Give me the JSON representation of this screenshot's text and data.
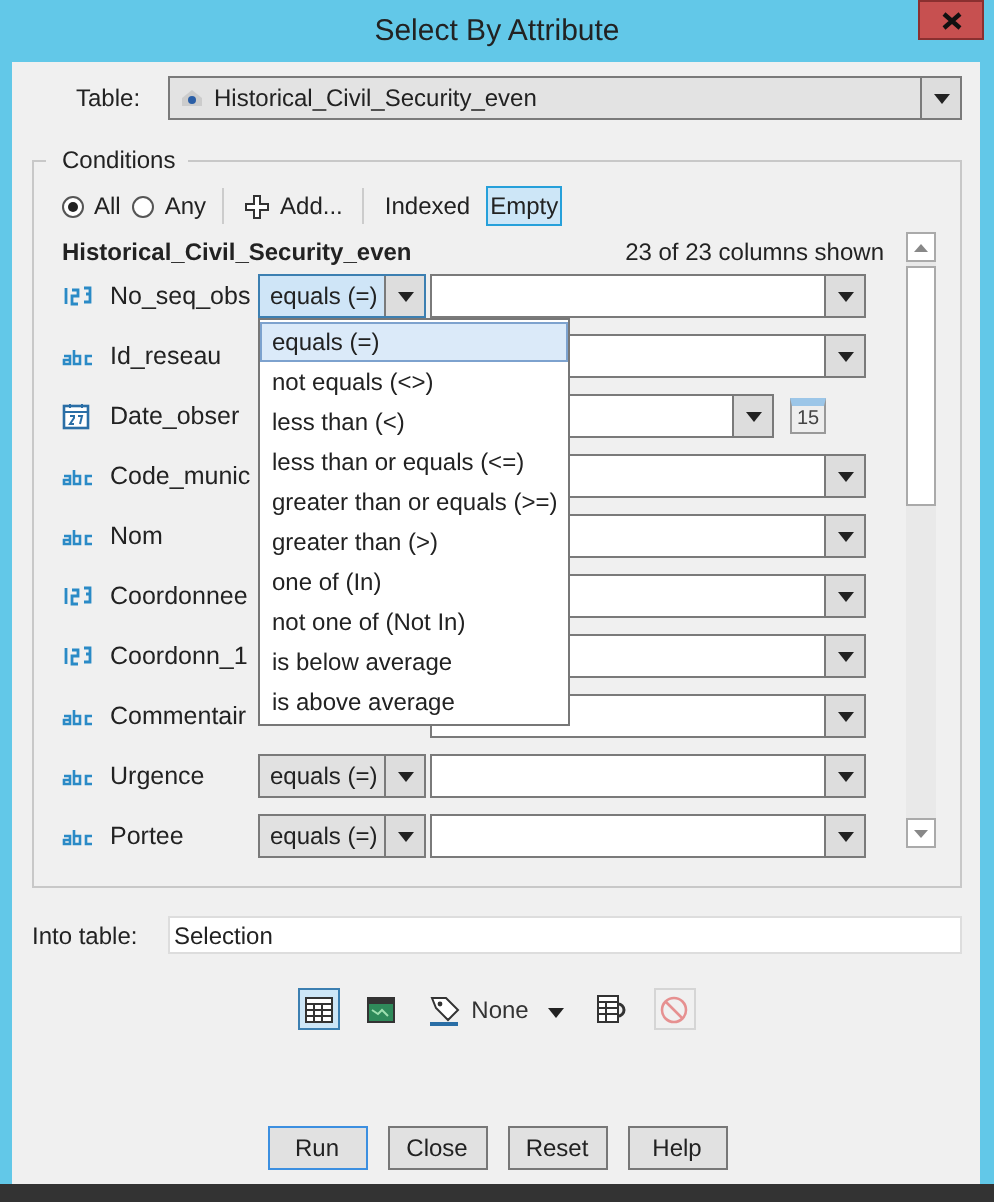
{
  "window": {
    "title": "Select By Attribute"
  },
  "table": {
    "label": "Table:",
    "value": "Historical_Civil_Security_even"
  },
  "conditions": {
    "title": "Conditions",
    "match": [
      {
        "label": "All",
        "selected": true
      },
      {
        "label": "Any",
        "selected": false
      }
    ],
    "add_label": "Add...",
    "filters": [
      {
        "label": "Indexed",
        "selected": false
      },
      {
        "label": "Empty",
        "selected": true
      }
    ],
    "layer_name": "Historical_Civil_Security_even",
    "columns_shown": "23 of 23 columns shown",
    "rows": [
      {
        "kind": "number",
        "field": "No_seq_obs",
        "operator": "equals (=)",
        "open": true
      },
      {
        "kind": "text",
        "field": "Id_reseau"
      },
      {
        "kind": "date",
        "field": "Date_obser",
        "date_button": "15"
      },
      {
        "kind": "text",
        "field": "Code_munic"
      },
      {
        "kind": "text",
        "field": "Nom"
      },
      {
        "kind": "number",
        "field": "Coordonnee"
      },
      {
        "kind": "number",
        "field": "Coordonn_1"
      },
      {
        "kind": "text",
        "field": "Commentair"
      },
      {
        "kind": "text",
        "field": "Urgence",
        "operator": "equals (=)",
        "open": false
      },
      {
        "kind": "text",
        "field": "Portee",
        "operator": "equals (=)",
        "open": false
      }
    ],
    "operator_menu": [
      {
        "label": "equals (=)",
        "selected": true
      },
      {
        "label": "not equals (<>)",
        "selected": false
      },
      {
        "label": "less than (<)",
        "selected": false
      },
      {
        "label": "less than or equals (<=)",
        "selected": false
      },
      {
        "label": "greater than or equals (>=)",
        "selected": false
      },
      {
        "label": "greater than (>)",
        "selected": false
      },
      {
        "label": "one of (In)",
        "selected": false
      },
      {
        "label": "not one of (Not In)",
        "selected": false
      },
      {
        "label": "is below average",
        "selected": false
      },
      {
        "label": "is above average",
        "selected": false
      }
    ]
  },
  "into_table": {
    "label": "Into table:",
    "value": "Selection"
  },
  "toolbar": [
    {
      "kind": "table",
      "selected": true,
      "disabled": false
    },
    {
      "kind": "map",
      "selected": false,
      "disabled": false
    },
    {
      "kind": "symbol",
      "selected": false,
      "disabled": false,
      "label": "None"
    },
    {
      "kind": "report",
      "selected": false,
      "disabled": false
    },
    {
      "kind": "clear",
      "selected": false,
      "disabled": true
    }
  ],
  "buttons": [
    {
      "label": "Run",
      "default": true
    },
    {
      "label": "Close",
      "default": false
    },
    {
      "label": "Reset",
      "default": false
    },
    {
      "label": "Help",
      "default": false
    }
  ]
}
